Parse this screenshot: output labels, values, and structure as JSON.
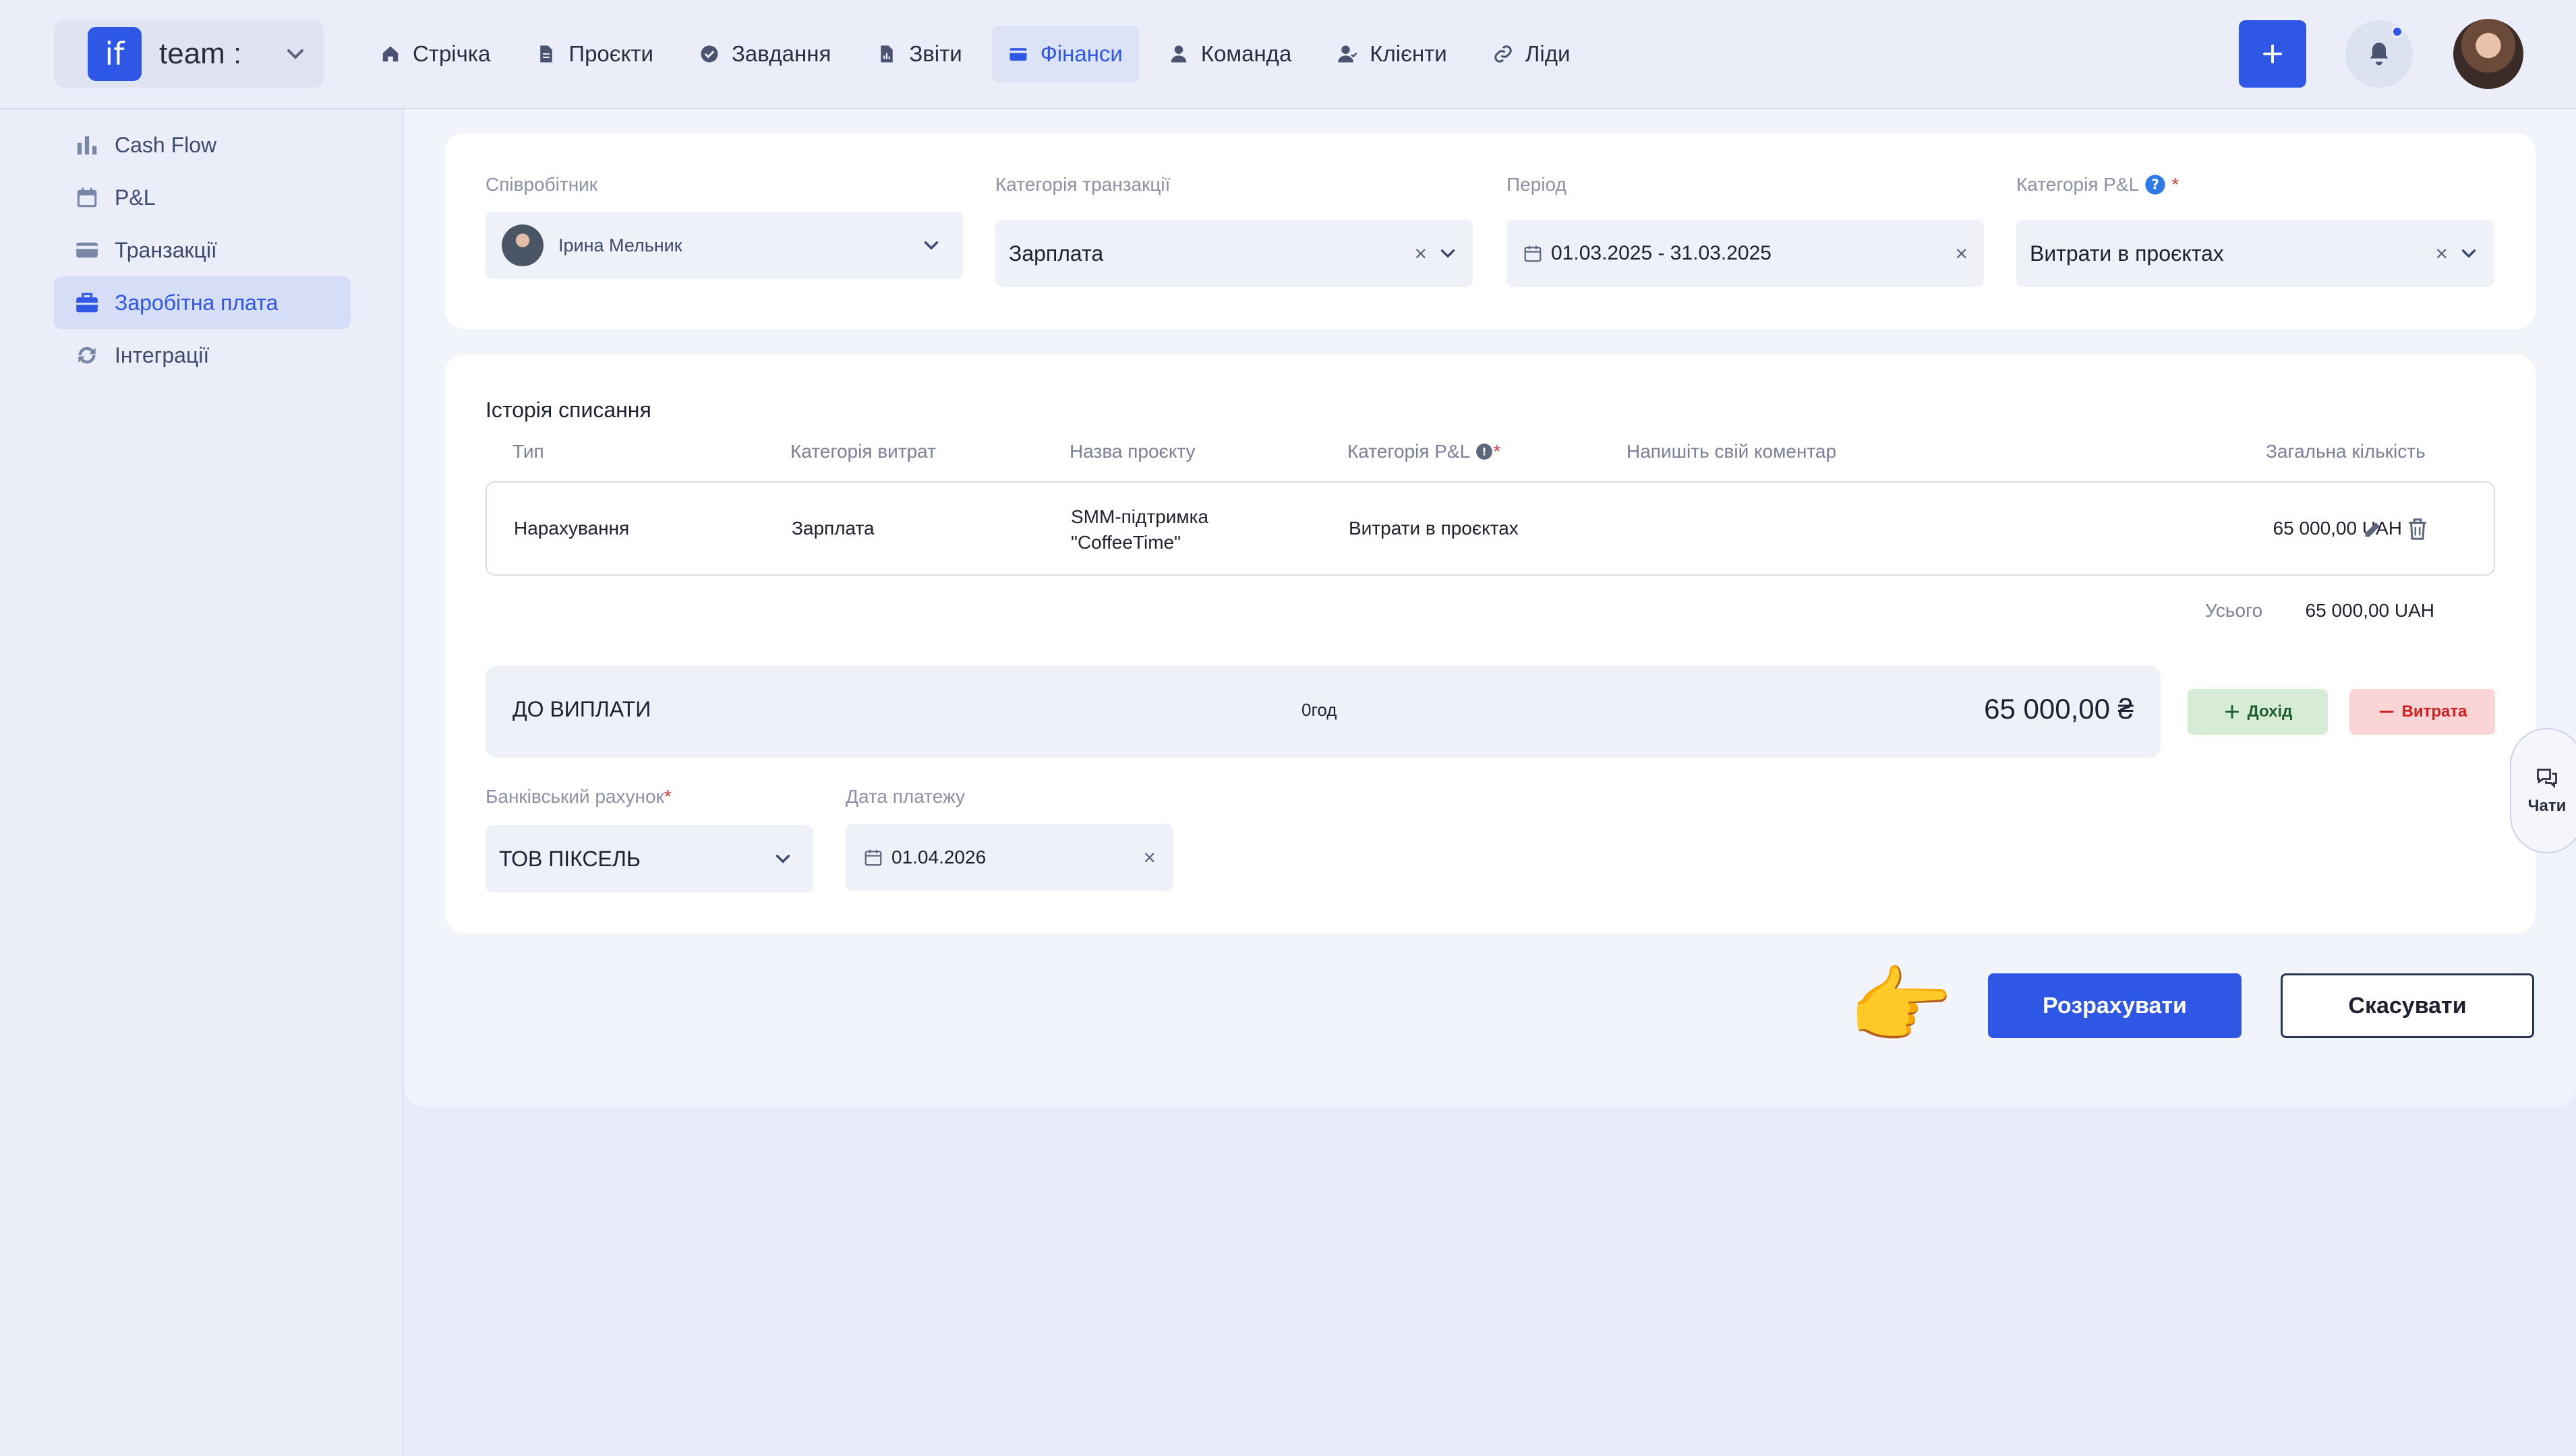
{
  "workspace": {
    "logo_text": "if",
    "name": "team :"
  },
  "nav": {
    "items": [
      {
        "label": "Стрічка",
        "icon": "home-icon"
      },
      {
        "label": "Проєкти",
        "icon": "document-icon"
      },
      {
        "label": "Завдання",
        "icon": "check-circle-icon"
      },
      {
        "label": "Звіти",
        "icon": "report-icon"
      },
      {
        "label": "Фінанси",
        "icon": "wallet-icon"
      },
      {
        "label": "Команда",
        "icon": "person-icon"
      },
      {
        "label": "Клієнти",
        "icon": "clients-icon"
      },
      {
        "label": "Ліди",
        "icon": "link-icon"
      }
    ],
    "active": "Фінанси"
  },
  "sidebar": {
    "items": [
      {
        "label": "Cash Flow",
        "icon": "bar-chart-icon"
      },
      {
        "label": "P&L",
        "icon": "calendar-icon"
      },
      {
        "label": "Транзакції",
        "icon": "card-icon"
      },
      {
        "label": "Заробітна плата",
        "icon": "briefcase-icon"
      },
      {
        "label": "Інтеграції",
        "icon": "sync-icon"
      }
    ],
    "active": "Заробітна плата"
  },
  "filters": {
    "employee": {
      "label": "Співробітник",
      "value": "Ірина Мельник"
    },
    "transaction_category": {
      "label": "Категорія транзакції",
      "value": "Зарплата"
    },
    "period": {
      "label": "Період",
      "value": "01.03.2025 - 31.03.2025"
    },
    "pl_category": {
      "label": "Категорія P&L",
      "required_mark": "*",
      "value": "Витрати в проєктах"
    }
  },
  "history": {
    "title": "Історія списання",
    "columns": {
      "type": "Тип",
      "expense_category": "Категорія витрат",
      "project": "Назва проєкту",
      "pl_category": "Категорія P&L",
      "pl_required": "*",
      "comment": "Напишіть свій коментар",
      "total": "Загальна кількість"
    },
    "rows": [
      {
        "type": "Нарахування",
        "expense_category": "Зарплата",
        "project_line1": "SMM-підтримка",
        "project_line2": "\"CoffeeTime\"",
        "pl_category": "Витрати в проєктах",
        "amount": "65 000,00 UAH"
      }
    ],
    "total_label": "Усього",
    "total_value": "65 000,00 UAH"
  },
  "payout": {
    "label": "ДО ВИПЛАТИ",
    "hours": "0год",
    "amount": "65 000,00 ₴",
    "income_label": "Дохід",
    "expense_label": "Витрата"
  },
  "payment": {
    "bank_label": "Банківський рахунок",
    "bank_required": "*",
    "bank_value": "ТОВ ПІКСЕЛЬ",
    "date_label": "Дата платежу",
    "date_value": "01.04.2026"
  },
  "chats_label": "Чати",
  "actions": {
    "calculate": "Розрахувати",
    "cancel": "Скасувати"
  },
  "colors": {
    "accent": "#2F57E6",
    "income_bg": "#D6ECD4",
    "income_text": "#1F5E2E",
    "expense_bg": "#FBD5D5",
    "expense_text": "#D32020"
  },
  "pointer_emoji": "👉"
}
